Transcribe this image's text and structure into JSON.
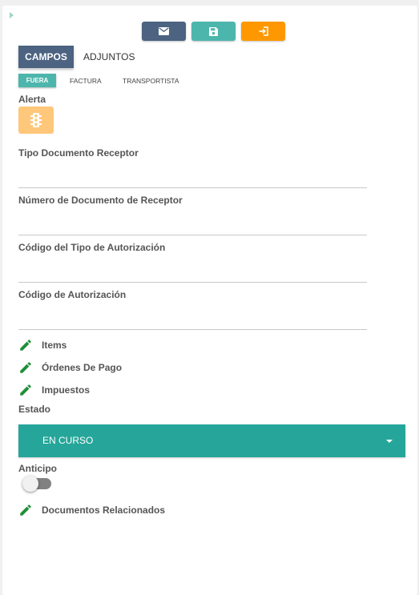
{
  "toolbar": {
    "buttons": [
      {
        "icon": "envelope-icon",
        "color": "#4c6381"
      },
      {
        "icon": "floppy-disk-icon",
        "color": "#4db6ac"
      },
      {
        "icon": "exit-icon",
        "color": "#ff9800"
      }
    ]
  },
  "tabs": {
    "items": [
      {
        "label": "CAMPOS",
        "active": true
      },
      {
        "label": "ADJUNTOS",
        "active": false
      }
    ]
  },
  "subtabs": {
    "items": [
      {
        "label": "FUERA",
        "active": true
      },
      {
        "label": "FACTURA",
        "active": false
      },
      {
        "label": "TRANSPORTISTA",
        "active": false
      }
    ]
  },
  "alert": {
    "label": "Alerta",
    "icon": "traffic-light-icon",
    "color": "#ffc77a"
  },
  "fields": [
    {
      "label": "Tipo Documento Receptor",
      "value": ""
    },
    {
      "label": "Número de Documento de Receptor",
      "value": ""
    },
    {
      "label": "Código del Tipo de Autorización",
      "value": ""
    },
    {
      "label": "Código de Autorización",
      "value": ""
    }
  ],
  "links": [
    {
      "label": "Items",
      "icon": "pencil-icon"
    },
    {
      "label": "Órdenes De Pago",
      "icon": "pencil-icon"
    },
    {
      "label": "Impuestos",
      "icon": "pencil-icon"
    }
  ],
  "estado": {
    "label": "Estado",
    "value": "EN CURSO",
    "color": "#26a69a"
  },
  "anticipo": {
    "label": "Anticipo",
    "checked": false
  },
  "documentos": {
    "label": "Documentos Relacionados",
    "icon": "pencil-icon"
  },
  "colors": {
    "accent": "#4db6ac",
    "primary": "#4c6381",
    "pencil": "#1e8f36"
  }
}
